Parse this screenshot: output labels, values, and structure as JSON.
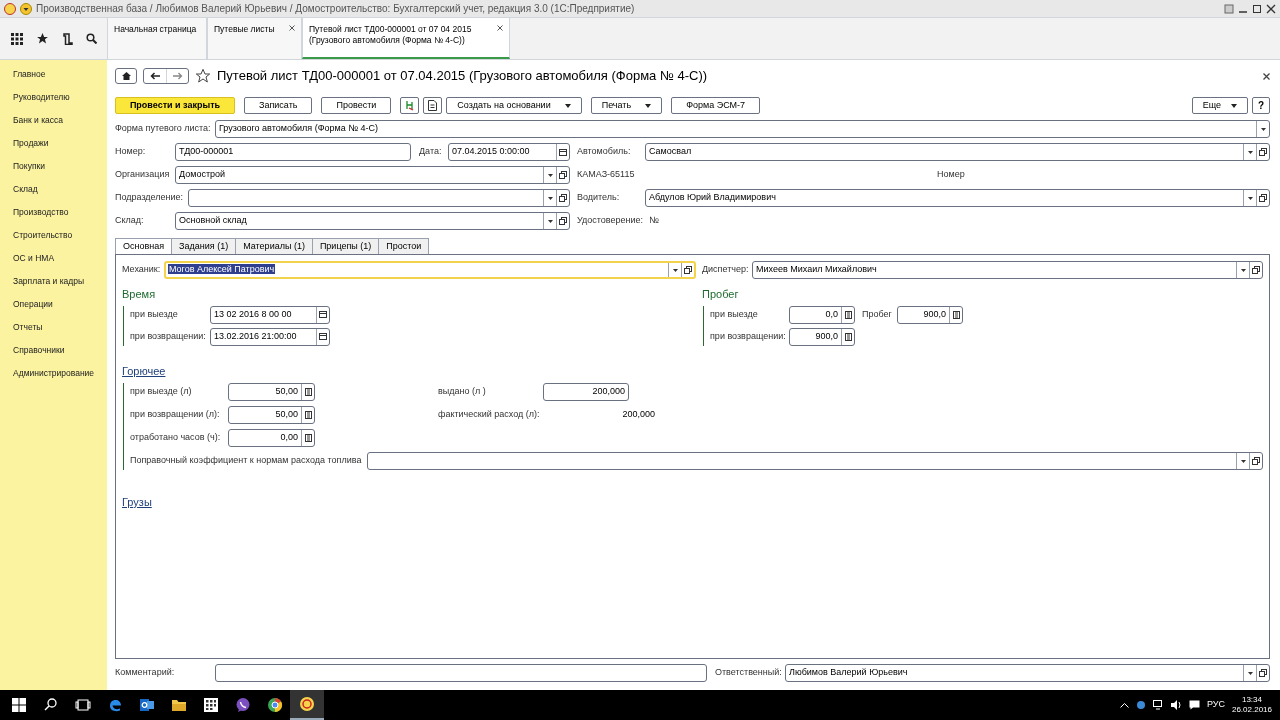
{
  "title_bar": {
    "title": "Производственная база / Любимов Валерий Юрьевич / Домостроительство: Бухгалтерский учет, редакция 3.0 (1С:Предприятие)"
  },
  "section_tabs": [
    {
      "label": "Начальная страница",
      "closable": false,
      "selected": false
    },
    {
      "label": "Путевые листы",
      "closable": true,
      "selected": false
    },
    {
      "label": "Путевой лист ТД00-000001 от 07 04 2015 (Грузового автомобиля (Форма № 4-С))",
      "closable": true,
      "selected": true
    }
  ],
  "sidebar": {
    "items": [
      {
        "label": "Главное"
      },
      {
        "label": "Руководителю"
      },
      {
        "label": "Банк и касса"
      },
      {
        "label": "Продажи"
      },
      {
        "label": "Покупки"
      },
      {
        "label": "Склад"
      },
      {
        "label": "Производство"
      },
      {
        "label": "Строительство"
      },
      {
        "label": "ОС и НМА"
      },
      {
        "label": "Зарплата и кадры"
      },
      {
        "label": "Операции"
      },
      {
        "label": "Отчеты"
      },
      {
        "label": "Справочники"
      },
      {
        "label": "Администрирование"
      }
    ]
  },
  "document": {
    "title": "Путевой лист ТД00-000001 от 07.04.2015 (Грузового автомобиля (Форма № 4-С))",
    "commands": [
      {
        "kind": "primary",
        "label": "Провести и закрыть"
      },
      {
        "kind": "plain",
        "label": "Записать"
      },
      {
        "kind": "plain",
        "label": "Провести"
      },
      {
        "kind": "icon"
      },
      {
        "kind": "icon"
      },
      {
        "kind": "menu",
        "label": "Создать на основании"
      },
      {
        "kind": "menu",
        "label": "Печать"
      },
      {
        "kind": "plain",
        "label": "Форма ЭСМ-7"
      }
    ],
    "more": {
      "label": "Еще"
    },
    "help": {
      "label": "?"
    }
  },
  "form_kind": {
    "label": "Форма путевого листа:",
    "value": "Грузового автомобиля (Форма № 4-С)"
  },
  "number": {
    "label": "Номер:",
    "value": "ТД00-000001"
  },
  "date": {
    "label": "Дата:",
    "value": "07.04.2015  0:00:00"
  },
  "organization": {
    "label": "Организация",
    "value": "Домострой"
  },
  "department": {
    "label": "Подразделение:"
  },
  "warehouse": {
    "label": "Склад:",
    "value": "Основной склад"
  },
  "car": {
    "label": "Автомобиль:",
    "value": "Самосвал"
  },
  "car_model": "КАМАЗ-65115",
  "plate_label": "Номер",
  "driver": {
    "label": "Водитель:",
    "value": "Абдулов Юрий Владимирович"
  },
  "license": {
    "label": "Удостоверение:",
    "value": "№"
  },
  "inner_tabs": [
    {
      "label": "Основная",
      "selected": true
    },
    {
      "label": "Задания (1)",
      "selected": false
    },
    {
      "label": "Материалы (1)",
      "selected": false
    },
    {
      "label": "Прицепы (1)",
      "selected": false
    },
    {
      "label": "Простои",
      "selected": false
    }
  ],
  "mechanic": {
    "label": "Механик:",
    "value": "Могов Алексей Патрович",
    "focused": true
  },
  "dispatcher": {
    "label": "Диспетчер:",
    "value": "Михеев Михаил Михайлович"
  },
  "time": {
    "title": "Время",
    "departure": {
      "label": "при выезде",
      "value": "13 02 2016  8 00 00"
    },
    "return": {
      "label": "при возвращении:",
      "value": "13.02.2016 21:00:00"
    }
  },
  "mileage": {
    "title": "Пробег",
    "departure": {
      "label": "при выезде",
      "value": "0,0"
    },
    "total": {
      "label": "Пробег",
      "value": "900,0"
    },
    "return": {
      "label": "при возвращении:",
      "value": "900,0"
    }
  },
  "fuel": {
    "title": "Горючее",
    "departure": {
      "label": "при выезде (л)",
      "value": "50,00"
    },
    "issued": {
      "label": "выдано (л )",
      "value": "200,000"
    },
    "return": {
      "label": "при возвращении (л):",
      "value": "50,00"
    },
    "consumption": {
      "label": "фактический расход (л):",
      "value": "200,000"
    },
    "hours": {
      "label": "отработано часов (ч):",
      "value": "0,00"
    },
    "coefficient": {
      "label": "Поправочный коэффициент к нормам расхода топлива"
    }
  },
  "cargo": {
    "title": "Грузы"
  },
  "comment": {
    "label": "Комментарий:"
  },
  "responsible": {
    "label": "Ответственный:",
    "value": "Любимов Валерий Юрьевич"
  },
  "taskbar": {
    "language": "РУС",
    "time": "13:34",
    "date": "26.02.2016"
  }
}
